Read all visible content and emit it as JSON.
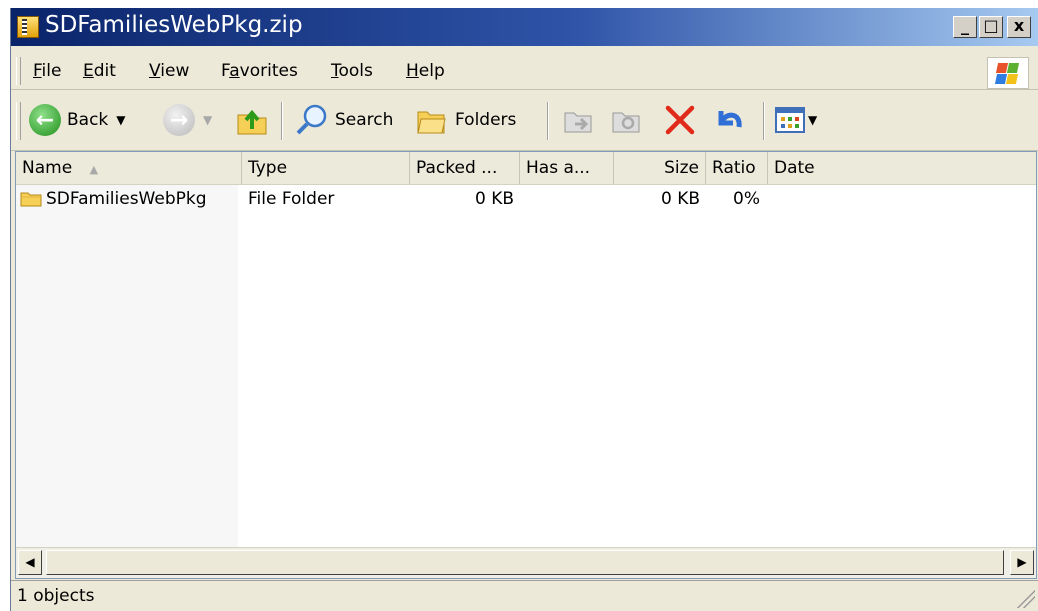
{
  "window": {
    "title": "SDFamiliesWebPkg.zip",
    "buttons": {
      "minimize": "_",
      "maximize": "□",
      "close": "x"
    }
  },
  "menu": {
    "items": [
      "File",
      "Edit",
      "View",
      "Favorites",
      "Tools",
      "Help"
    ]
  },
  "toolbar": {
    "back_label": "Back",
    "search_label": "Search",
    "folders_label": "Folders"
  },
  "list": {
    "columns": [
      "Name",
      "Type",
      "Packed ...",
      "Has a...",
      "Size",
      "Ratio",
      "Date"
    ],
    "sort_indicator": "▲",
    "rows": [
      {
        "name": "SDFamiliesWebPkg",
        "type": "File Folder",
        "packed": "0 KB",
        "has_a": "",
        "size": "0 KB",
        "ratio": "0%",
        "date": ""
      }
    ]
  },
  "status": {
    "text": "1 objects"
  },
  "colors": {
    "title_start": "#0a246a",
    "title_end": "#a6caf0",
    "chrome": "#ece9d8"
  }
}
